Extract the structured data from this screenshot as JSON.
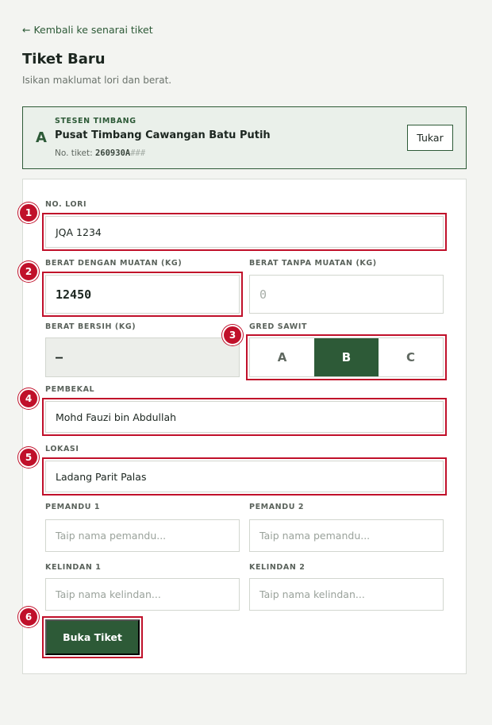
{
  "nav": {
    "back_link": "← Kembali ke senarai tiket"
  },
  "header": {
    "title": "Tiket Baru",
    "subtitle": "Isikan maklumat lori dan berat."
  },
  "station": {
    "letter": "A",
    "label": "STESEN TIMBANG",
    "name": "Pusat Timbang Cawangan Batu Putih",
    "ticket_prefix": "No. tiket: ",
    "ticket_number": "260930A",
    "ticket_suffix": "###",
    "swap_button": "Tukar"
  },
  "form": {
    "lorry_no": {
      "label": "NO. LORI",
      "value": "JQA 1234"
    },
    "gross_weight": {
      "label": "BERAT DENGAN MUATAN (KG)",
      "value": "12450"
    },
    "tare_weight": {
      "label": "BERAT TANPA MUATAN (KG)",
      "value": "0"
    },
    "net_weight": {
      "label": "BERAT BERSIH (KG)",
      "value": "—"
    },
    "grade": {
      "label": "GRED SAWIT",
      "options": [
        "A",
        "B",
        "C"
      ],
      "selected": "B"
    },
    "supplier": {
      "label": "PEMBEKAL",
      "value": "Mohd Fauzi bin Abdullah"
    },
    "location": {
      "label": "LOKASI",
      "value": "Ladang Parit Palas"
    },
    "driver1": {
      "label": "PEMANDU 1",
      "placeholder": "Taip nama pemandu..."
    },
    "driver2": {
      "label": "PEMANDU 2",
      "placeholder": "Taip nama pemandu..."
    },
    "attendant1": {
      "label": "KELINDAN 1",
      "placeholder": "Taip nama kelindan..."
    },
    "attendant2": {
      "label": "KELINDAN 2",
      "placeholder": "Taip nama kelindan..."
    },
    "submit": "Buka Tiket"
  },
  "markers": [
    "1",
    "2",
    "3",
    "4",
    "5",
    "6"
  ],
  "colors": {
    "primary": "#2d5a37",
    "highlight": "#c0102a",
    "station_bg": "#eaf0ea"
  }
}
